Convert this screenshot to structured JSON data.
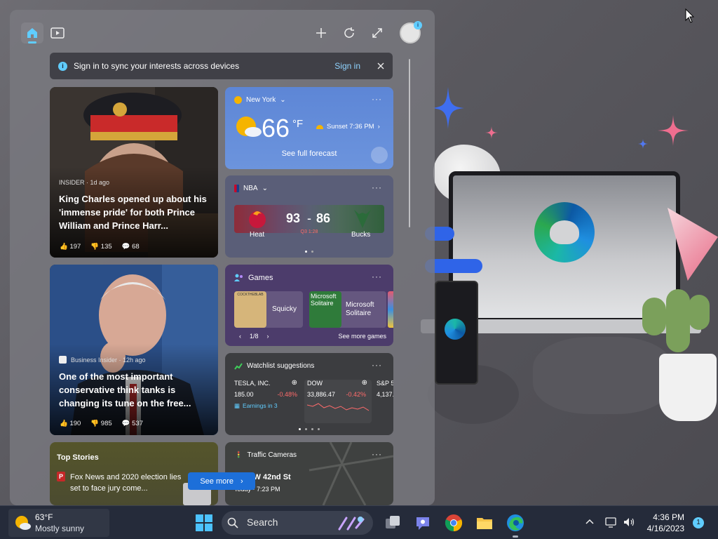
{
  "panel": {
    "signin": {
      "text": "Sign in to sync your interests across devices",
      "link": "Sign in"
    },
    "news1": {
      "source": "INSIDER · 1d ago",
      "headline": "King Charles opened up about his 'immense pride' for both Prince William and Prince Harr...",
      "likes": "197",
      "dislikes": "135",
      "comments": "68"
    },
    "news2": {
      "source": "Business Insider · 12h ago",
      "headline": "One of the most important conservative think tanks is changing its tune on the free...",
      "likes": "190",
      "dislikes": "985",
      "comments": "537"
    },
    "weather": {
      "location": "New York",
      "temp": "66",
      "unit": "°F",
      "sunset": "Sunset 7:36 PM",
      "forecast_link": "See full forecast"
    },
    "nba": {
      "label": "NBA",
      "home_team": "Heat",
      "away_team": "Bucks",
      "home_score": "93",
      "away_score": "86",
      "separator": "-",
      "period": "Q3 1:28"
    },
    "games": {
      "label": "Games",
      "items": [
        "Squicky",
        "Microsoft Solitaire"
      ],
      "pager": "1/8",
      "more_link": "See more games",
      "thumb_text": [
        "Microsoft Solitaire"
      ],
      "thumb_header": "COCKTHEBLAB"
    },
    "watchlist": {
      "label": "Watchlist suggestions",
      "stocks": [
        {
          "name": "TESLA, INC.",
          "price": "185.00",
          "change": "-0.48%",
          "extra": "Earnings in 3"
        },
        {
          "name": "DOW",
          "price": "33,886.47",
          "change": "-0.42%",
          "extra": ""
        },
        {
          "name": "S&P 5",
          "price": "4,137.",
          "change": "",
          "extra": ""
        }
      ]
    },
    "top_stories": {
      "label": "Top Stories",
      "headline": "Fox News and 2020 election lies set to face jury come..."
    },
    "traffic": {
      "label": "Traffic Cameras",
      "street": "ave / W 42nd St",
      "time": "Today · 7:23 PM"
    },
    "see_more": "See more"
  },
  "taskbar": {
    "weather_temp": "63°F",
    "weather_desc": "Mostly sunny",
    "search_placeholder": "Search",
    "time": "4:36 PM",
    "date": "4/16/2023",
    "notif_count": "1"
  },
  "colors": {
    "accent": "#60cdff",
    "negative": "#ff6b6b",
    "button": "#1d6fd9"
  }
}
